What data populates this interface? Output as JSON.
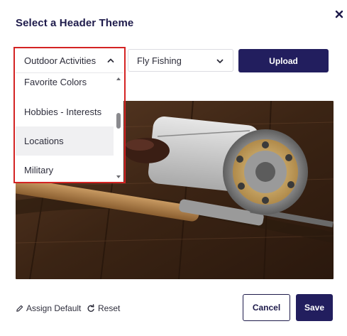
{
  "dialog": {
    "title": "Select a Header Theme"
  },
  "category_select": {
    "value": "Outdoor Activities",
    "expanded": true,
    "options_visible": [
      "Favorite Colors",
      "Hobbies - Interests",
      "Locations",
      "Military"
    ],
    "hovered_option": "Locations"
  },
  "subcategory_select": {
    "value": "Fly Fishing"
  },
  "buttons": {
    "upload": "Upload",
    "cancel": "Cancel",
    "save": "Save"
  },
  "links": {
    "assign_default": "Assign Default",
    "reset": "Reset"
  },
  "icons": {
    "close": "close-icon",
    "chevron_up": "chevron-up-icon",
    "chevron_down": "chevron-down-icon",
    "pencil": "pencil-icon",
    "reset": "reset-icon"
  },
  "colors": {
    "primary": "#221e5e",
    "highlight_border": "#d42323"
  }
}
